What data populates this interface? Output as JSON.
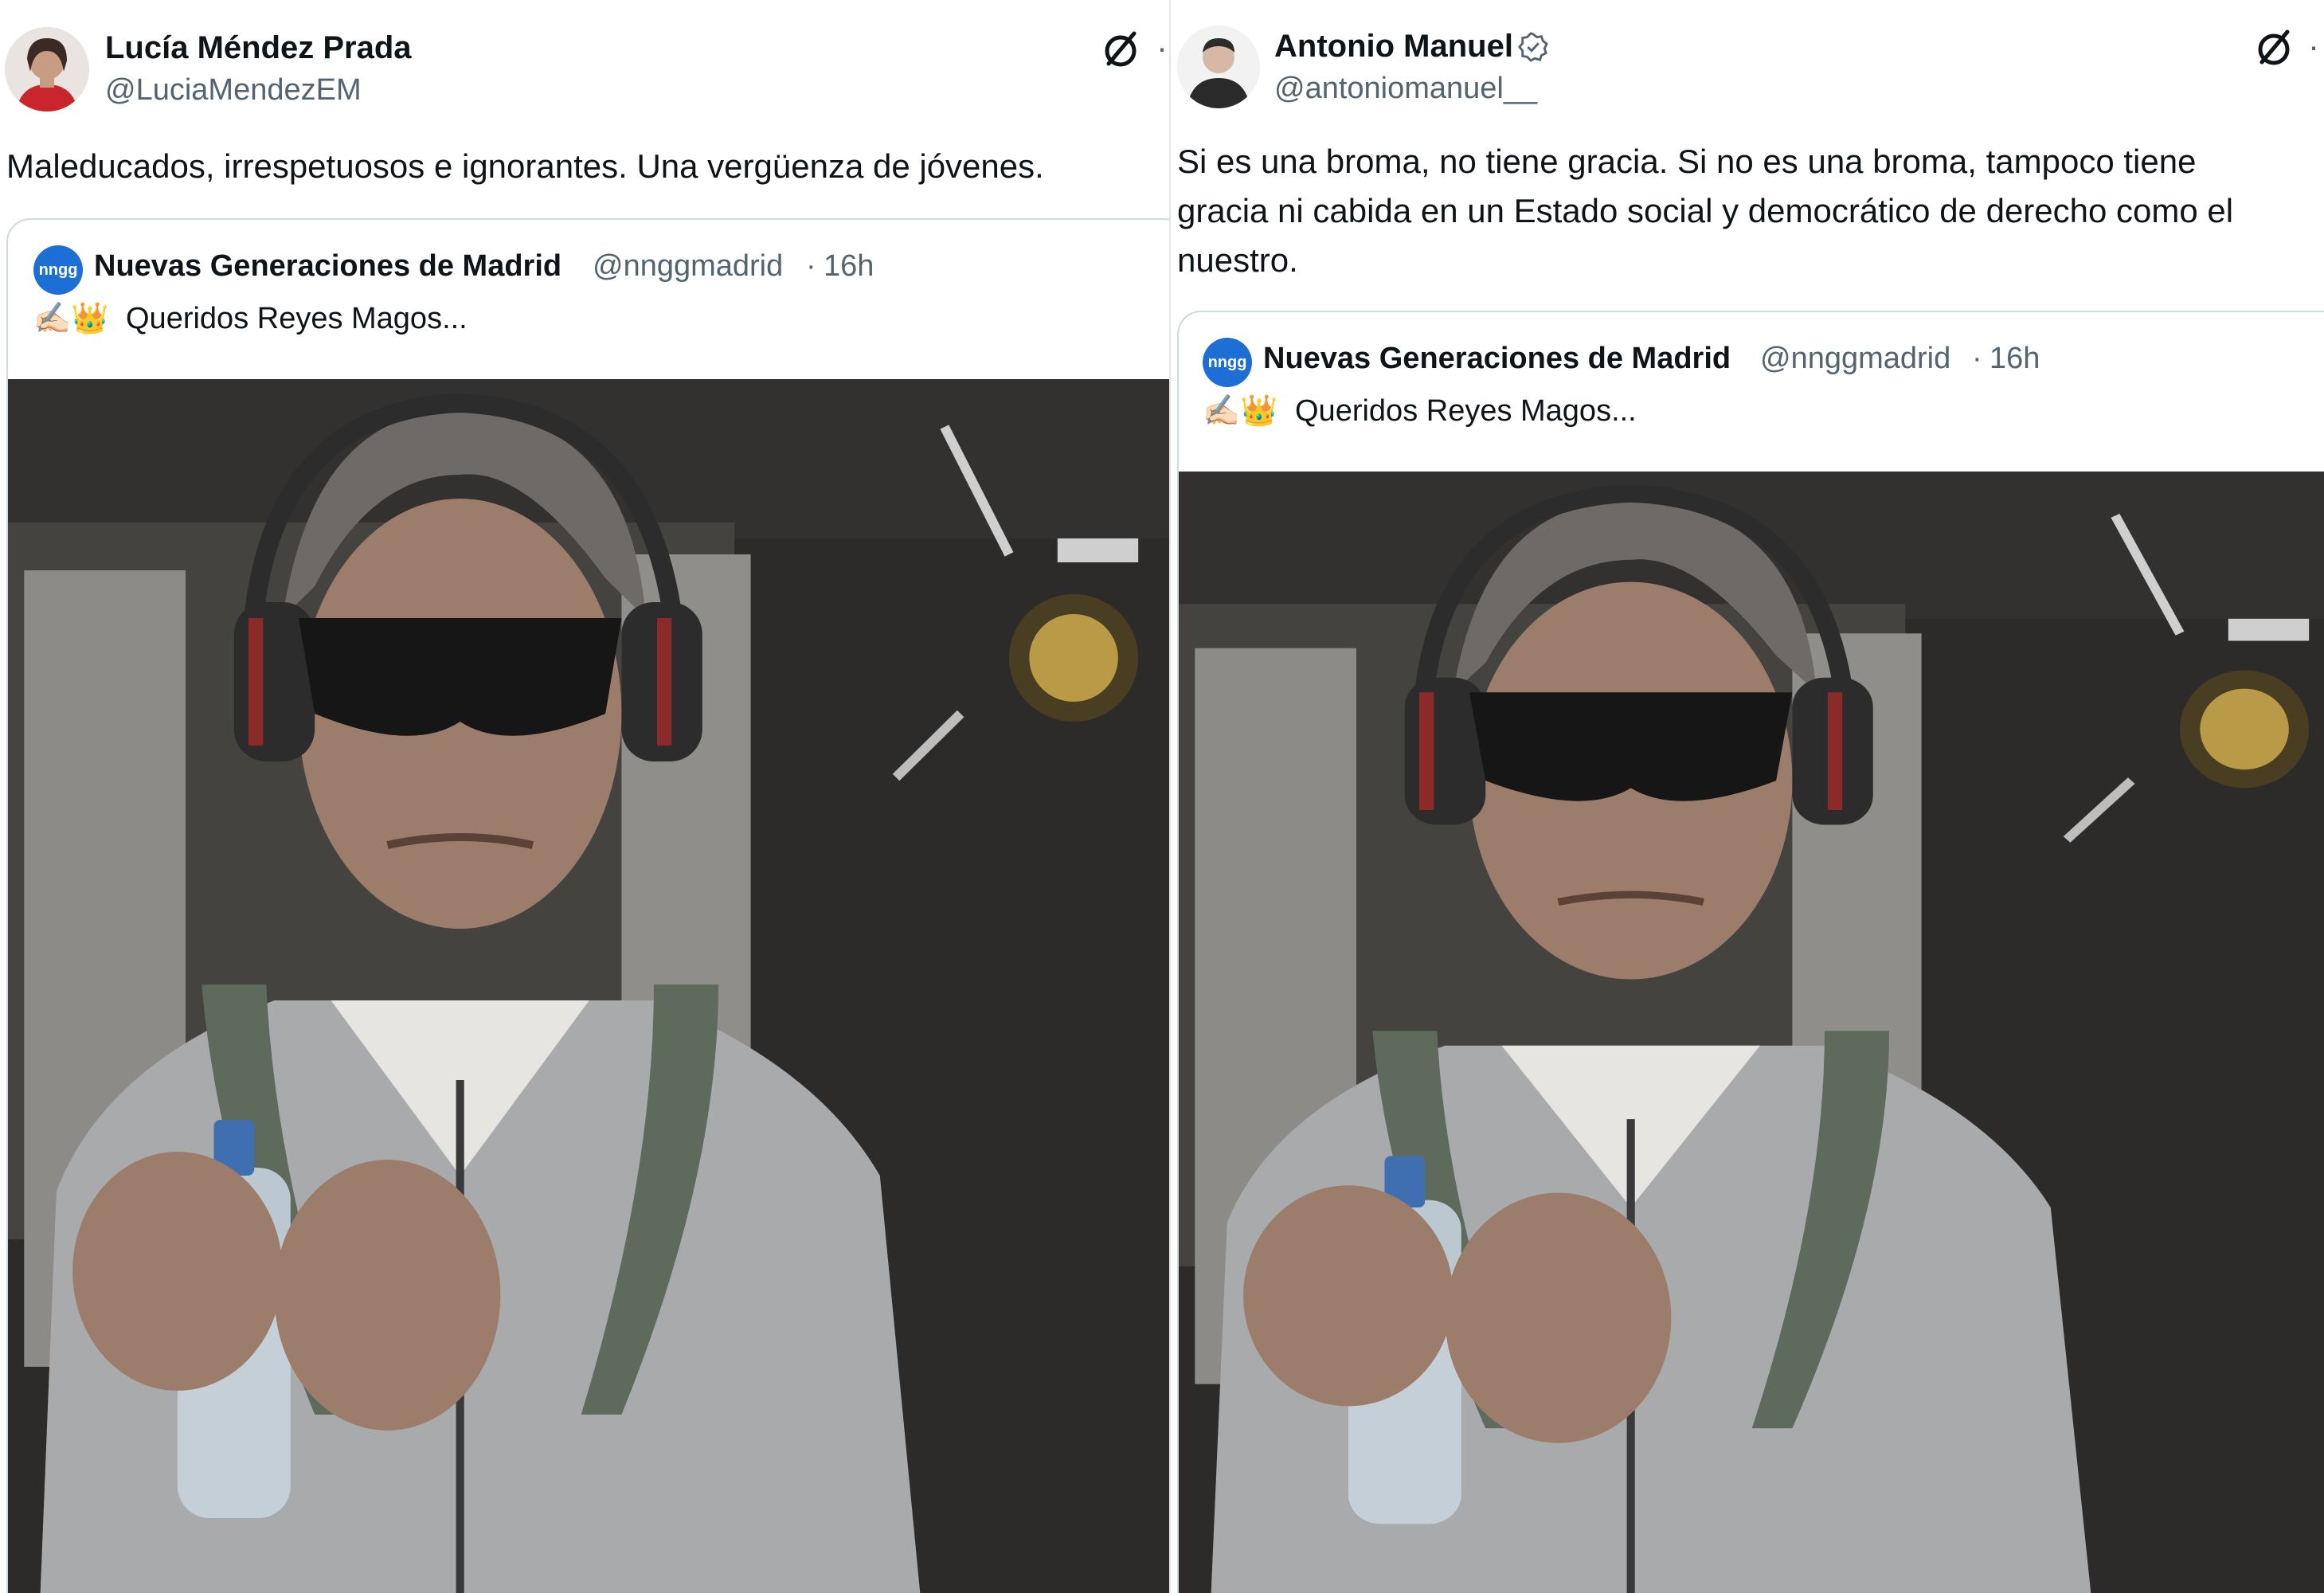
{
  "left_tweet": {
    "author_name": "Lucía Méndez Prada",
    "author_handle": "@LuciaMendezEM",
    "text": "Maleducados, irrespetuosos e ignorantes. Una vergüenza de jóvenes.",
    "grok_icon": "grok-icon",
    "more_glyph": "·",
    "quote": {
      "avatar_text": "nngg",
      "name": "Nuevas Generaciones de Madrid",
      "handle": "@nnggmadrid",
      "separator": "·",
      "time": "16h",
      "emoji": "✍🏻👑",
      "text": "Queridos Reyes Magos..."
    }
  },
  "right_tweet": {
    "author_name": "Antonio Manuel",
    "verified_icon": "verified-badge-icon",
    "author_handle": "@antoniomanuel__",
    "text": "Si es una broma, no tiene gracia. Si no es una broma, tampoco tiene\ngracia ni cabida en un Estado social y democrático de derecho como el\nnuestro.",
    "grok_icon": "grok-icon",
    "more_glyph": "·",
    "quote": {
      "avatar_text": "nngg",
      "name": "Nuevas Generaciones de Madrid",
      "handle": "@nnggmadrid",
      "separator": "·",
      "time": "16h",
      "emoji": "✍🏻👑",
      "text": "Queridos Reyes Magos..."
    }
  },
  "photo_scene": {
    "description_icon": "blindfolded-man-with-headphones-photo",
    "colors": {
      "background": "#33312f",
      "jacket": "#a9aaac",
      "glasses": "#161616",
      "skin": "#9c7c6b",
      "hair": "#6d6a67",
      "headphones": "#2c2c2c",
      "accent_red": "#8c2a2a"
    }
  }
}
